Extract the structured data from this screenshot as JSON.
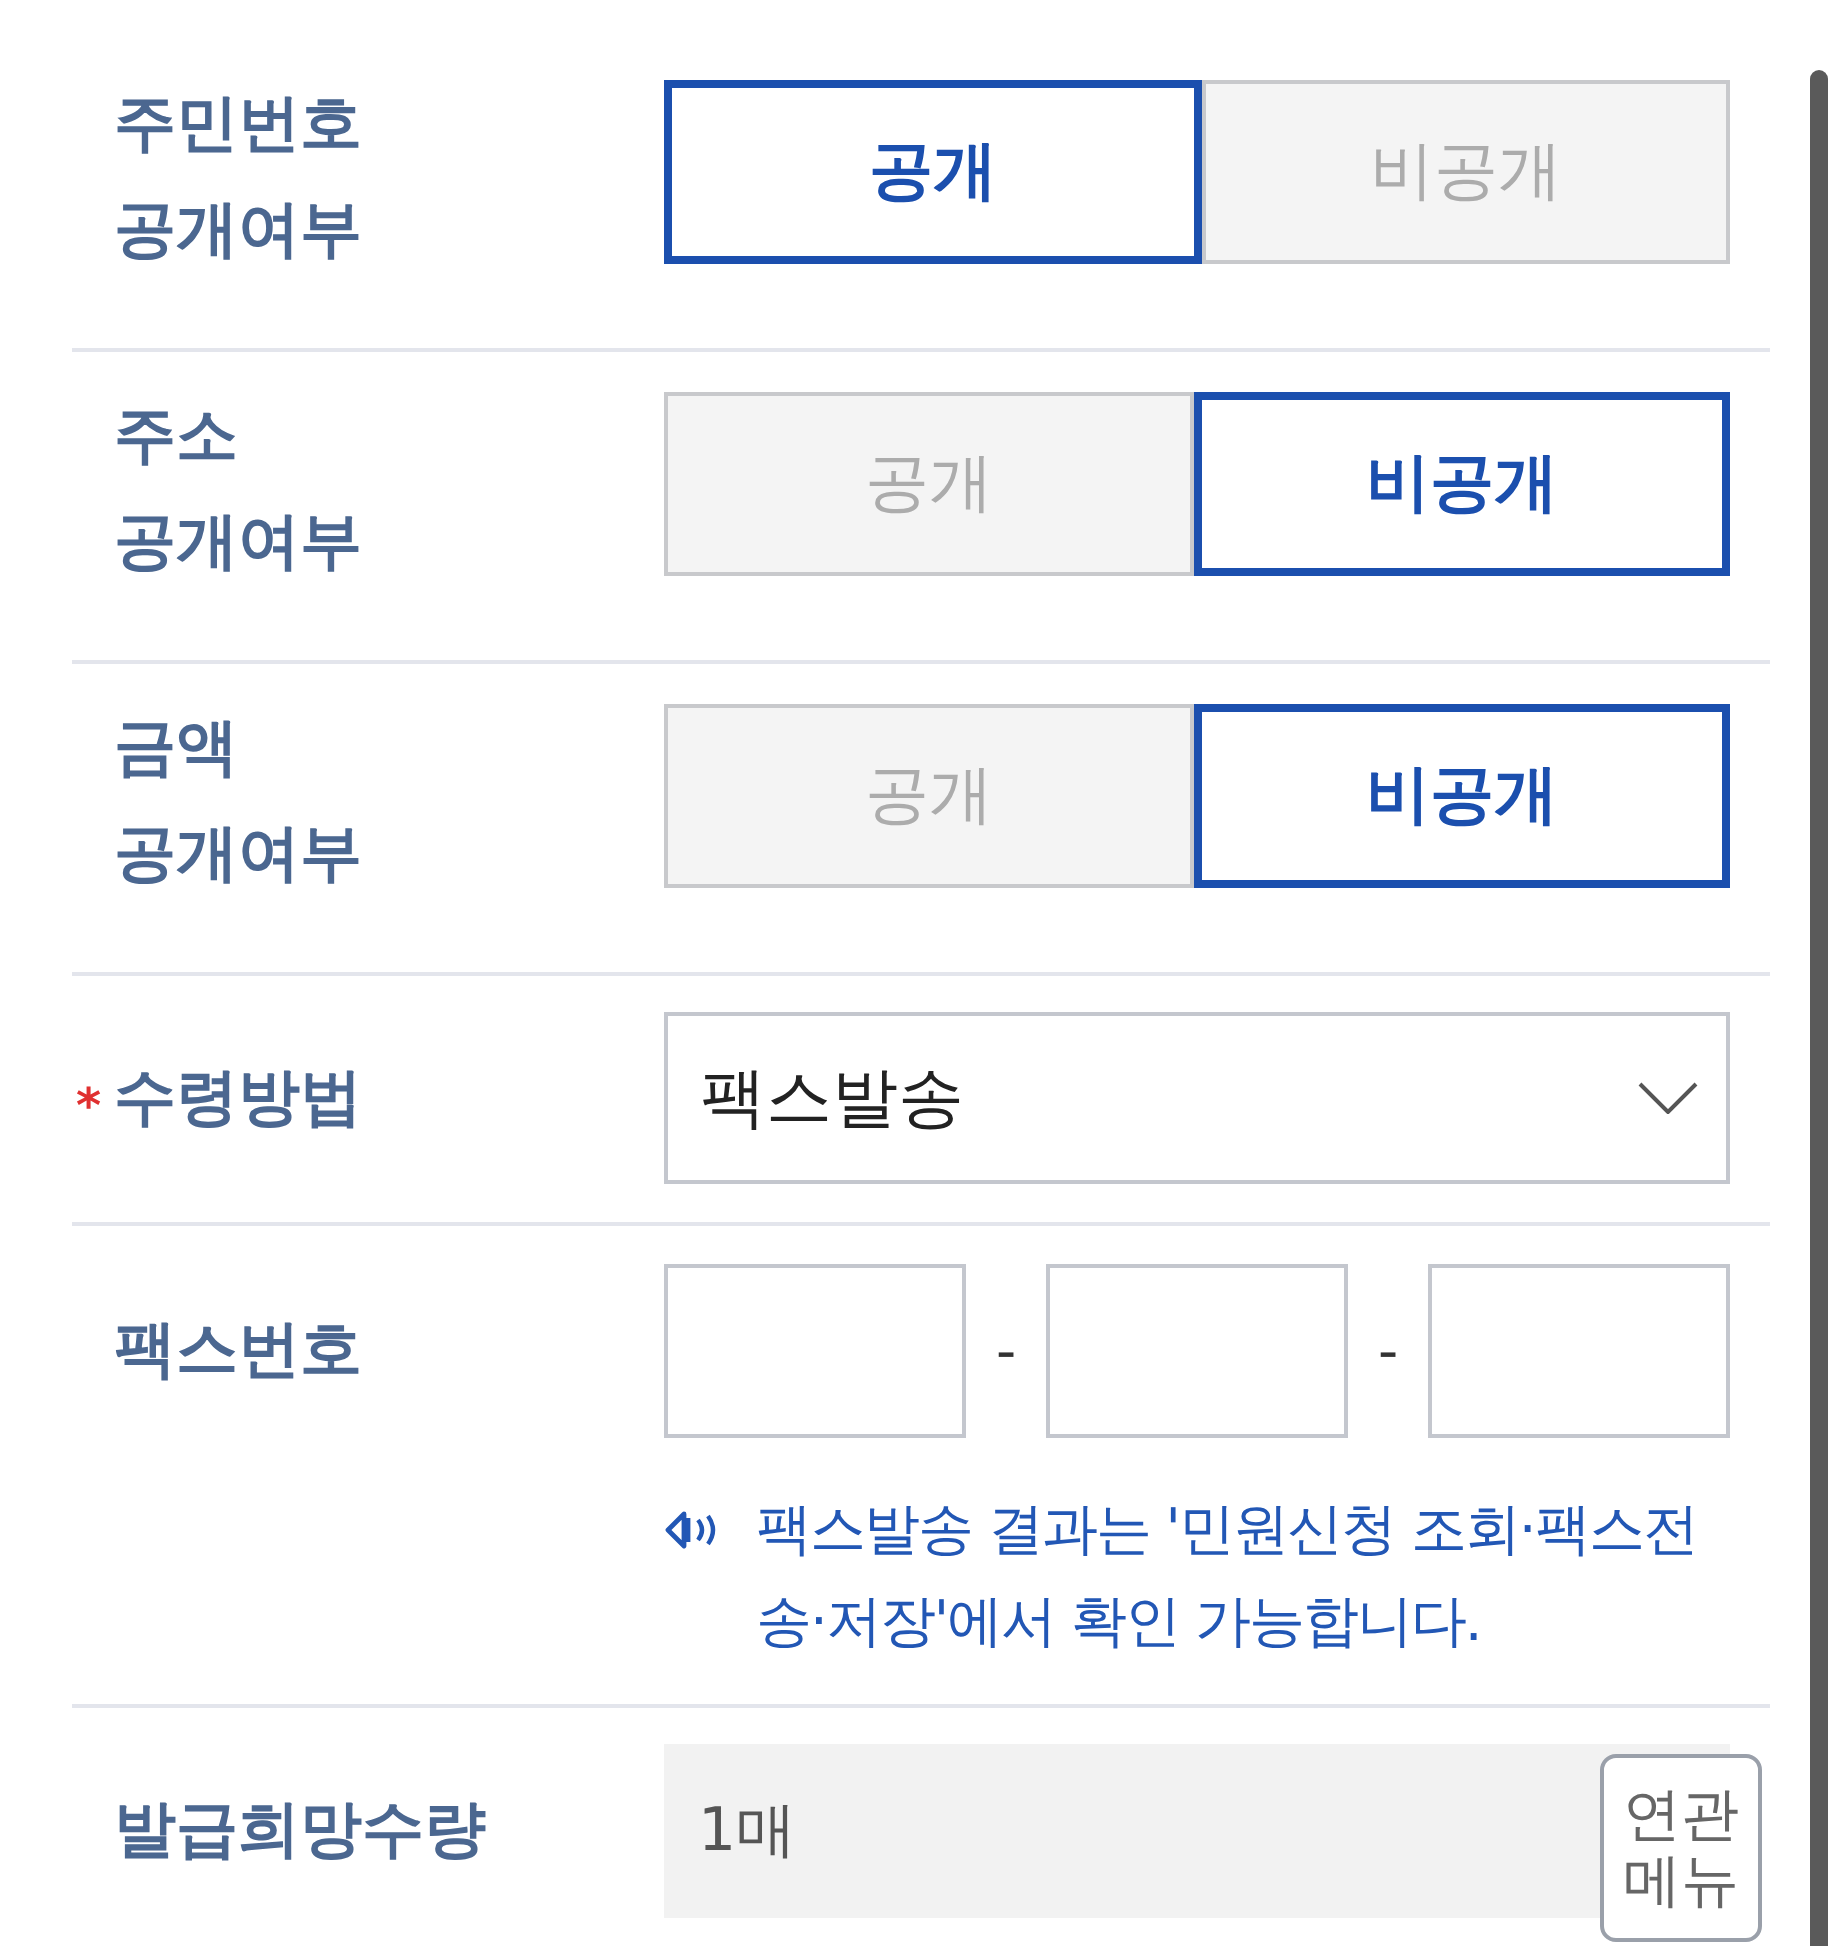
{
  "rows": [
    {
      "kind": "toggle",
      "label": "주민번호\n공개여부",
      "options": [
        {
          "label": "공개",
          "selected": true
        },
        {
          "label": "비공개",
          "selected": false
        }
      ]
    },
    {
      "kind": "toggle",
      "label": "주소\n공개여부",
      "options": [
        {
          "label": "공개",
          "selected": false
        },
        {
          "label": "비공개",
          "selected": true
        }
      ]
    },
    {
      "kind": "toggle",
      "label": "금액\n공개여부",
      "options": [
        {
          "label": "공개",
          "selected": false
        },
        {
          "label": "비공개",
          "selected": true
        }
      ]
    },
    {
      "kind": "select",
      "label": "수령방법",
      "required_mark": "*",
      "value": "팩스발송"
    },
    {
      "kind": "fax",
      "label": "팩스번호",
      "fields": [
        {
          "kind": "input"
        },
        {
          "kind": "separator",
          "text": "-"
        },
        {
          "kind": "input"
        },
        {
          "kind": "separator",
          "text": "-"
        },
        {
          "kind": "input"
        }
      ],
      "notice": "팩스발송 결과는 '민원신청 조회·팩스전송·저장'에서 확인 가능합니다."
    },
    {
      "kind": "readonly",
      "label": "발급희망수량",
      "value": "1매",
      "disabled": true
    }
  ],
  "floating_button": {
    "label": "연관 메뉴"
  }
}
